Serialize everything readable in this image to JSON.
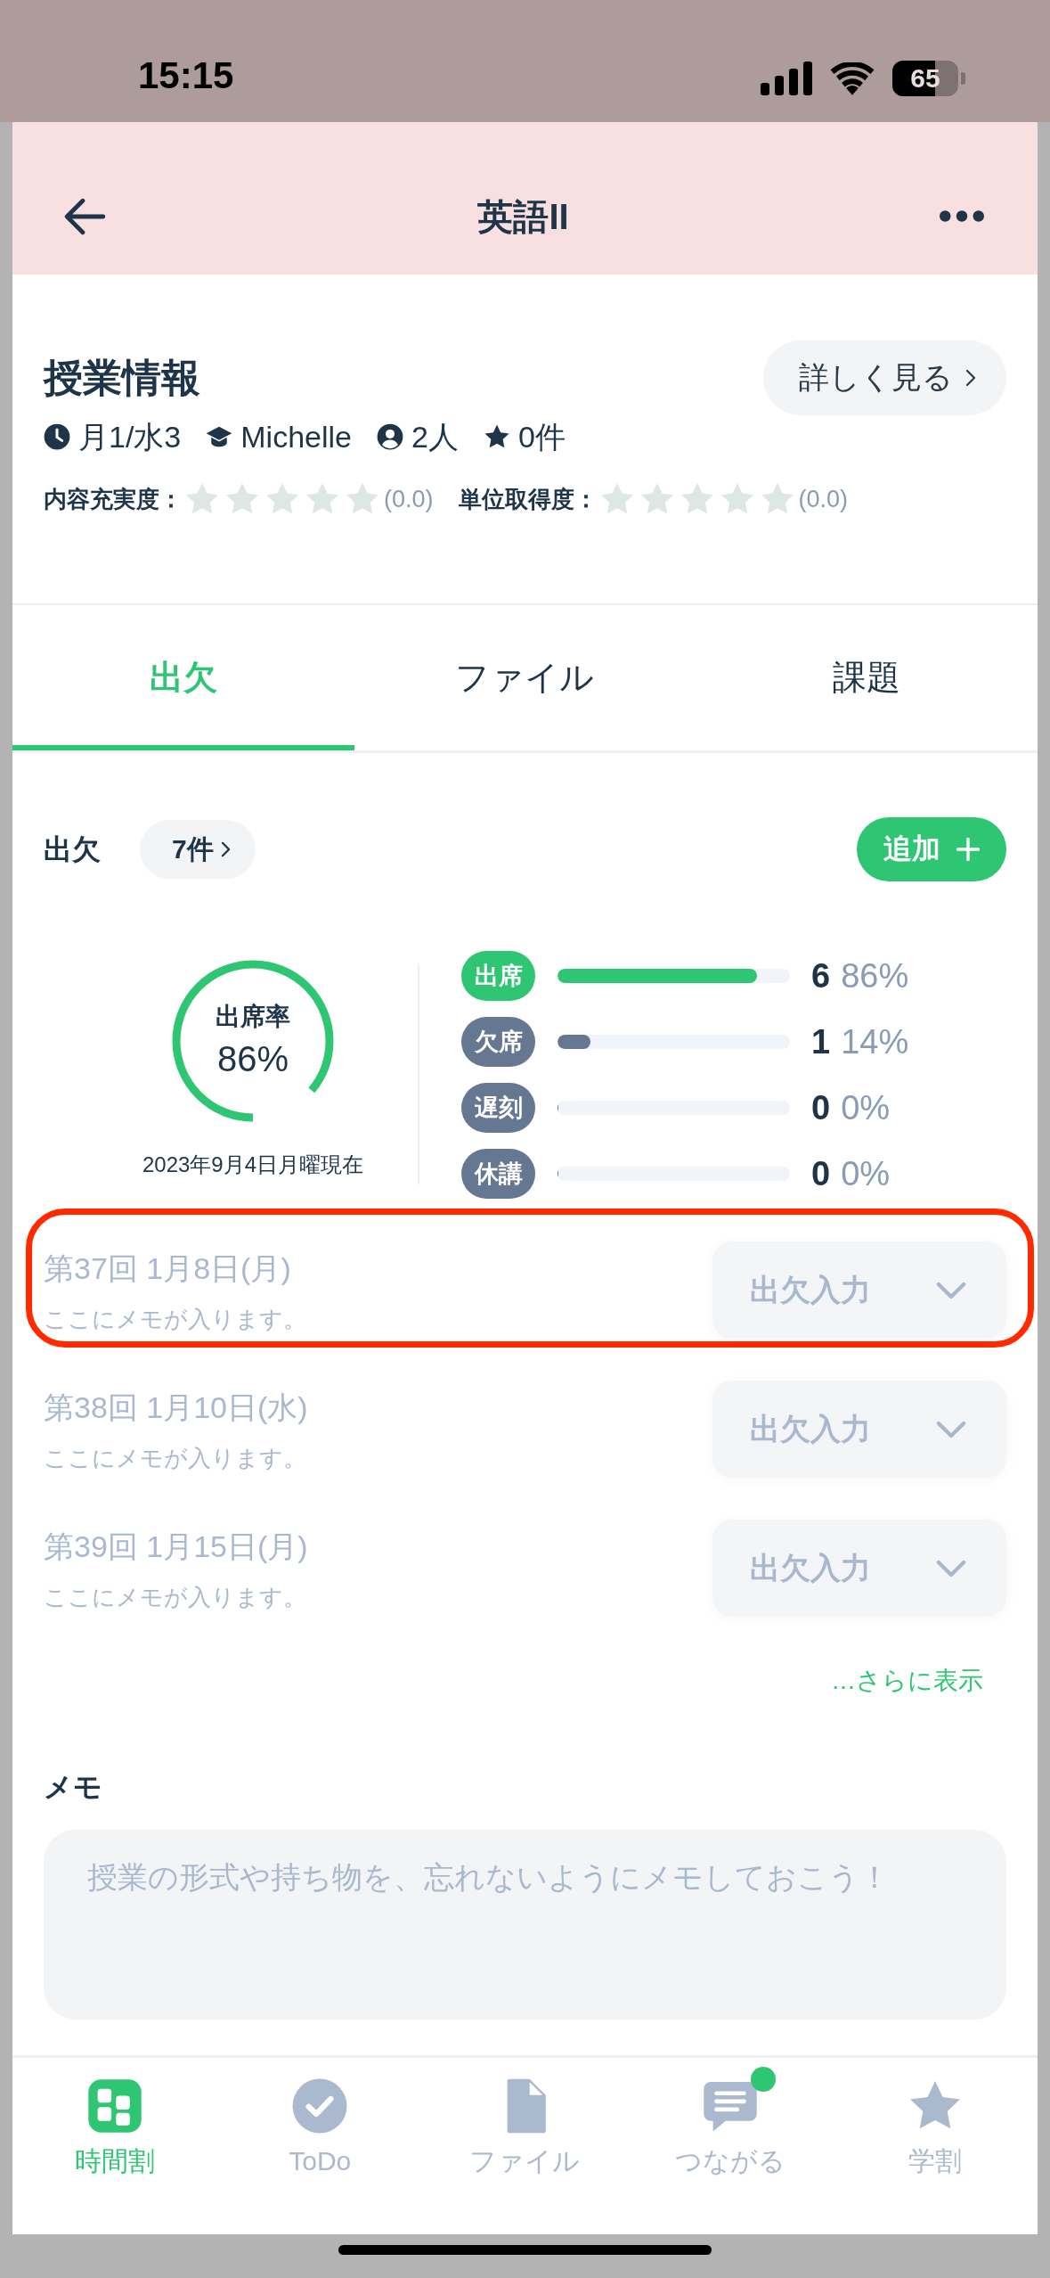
{
  "status_bar": {
    "time": "15:15",
    "battery": "65"
  },
  "header": {
    "title": "英語II"
  },
  "course_info": {
    "title": "授業情報",
    "details_button": "詳しく見る",
    "meta": [
      {
        "kind": "schedule",
        "text": "月1/水3"
      },
      {
        "kind": "teacher",
        "text": "Michelle"
      },
      {
        "kind": "members",
        "text": "2人"
      },
      {
        "kind": "favorites",
        "text": "0件"
      }
    ],
    "ratings": [
      {
        "label": "内容充実度：",
        "stars": 0,
        "score": "(0.0)"
      },
      {
        "label": "単位取得度：",
        "stars": 0,
        "score": "(0.0)"
      }
    ]
  },
  "tabs": [
    {
      "label": "出欠",
      "selected": true
    },
    {
      "label": "ファイル",
      "selected": false
    },
    {
      "label": "課題",
      "selected": false
    }
  ],
  "attendance": {
    "title": "出欠",
    "count_button": "7件",
    "add_button": "追加",
    "rate": {
      "label": "出席率",
      "value": "86%",
      "level": 0.86
    },
    "as_of": "2023年9月4日月曜現在",
    "stats": [
      {
        "label": "出席",
        "color": "#2ec673",
        "level": 0.86,
        "count": "6",
        "percent": "86%"
      },
      {
        "label": "欠席",
        "color": "#667792",
        "level": 0.14,
        "count": "1",
        "percent": "14%"
      },
      {
        "label": "遅刻",
        "color": "#667792",
        "level": 0,
        "count": "0",
        "percent": "0%"
      },
      {
        "label": "休講",
        "color": "#667792",
        "level": 0,
        "count": "0",
        "percent": "0%"
      }
    ],
    "sessions": [
      {
        "title": "第37回 1月8日(月)",
        "memo": "ここにメモが入ります。",
        "dropdown": "出欠入力",
        "highlighted": true
      },
      {
        "title": "第38回 1月10日(水)",
        "memo": "ここにメモが入ります。",
        "dropdown": "出欠入力",
        "highlighted": false
      },
      {
        "title": "第39回 1月15日(月)",
        "memo": "ここにメモが入ります。",
        "dropdown": "出欠入力",
        "highlighted": false
      }
    ],
    "more_link": "…さらに表示"
  },
  "memo": {
    "title": "メモ",
    "placeholder": "授業の形式や持ち物を、忘れないようにメモしておこう！"
  },
  "bottom_nav": [
    {
      "kind": "timetable",
      "label": "時間割",
      "selected": true,
      "badge": false
    },
    {
      "kind": "todo",
      "label": "ToDo",
      "selected": false,
      "badge": false
    },
    {
      "kind": "file",
      "label": "ファイル",
      "selected": false,
      "badge": false
    },
    {
      "kind": "chat",
      "label": "つながる",
      "selected": false,
      "badge": true
    },
    {
      "kind": "star",
      "label": "学割",
      "selected": false,
      "badge": false
    }
  ]
}
